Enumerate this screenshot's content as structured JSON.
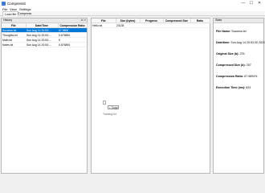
{
  "window": {
    "title": "Compressit",
    "minimize": "—",
    "maximize": "☐",
    "close": "✕"
  },
  "menu": [
    "File",
    "View",
    "Settings"
  ],
  "toolbar": {
    "tabs": [
      "Load file",
      "Compress"
    ]
  },
  "history": {
    "title": "History",
    "columns": [
      "File",
      "Date/Time",
      "Compression Ratio"
    ],
    "rows": [
      {
        "file": "Success.txt",
        "date": "Sun Aug 14 20:53:...",
        "ratio": "67.9894"
      },
      {
        "file": "Thoughts.txt",
        "date": "Sun Aug 14 20:53:...",
        "ratio": "0.675894"
      },
      {
        "file": "Math.txt",
        "date": "Sun Aug 14 20:53:...",
        "ratio": "5"
      },
      {
        "file": "Notes.txt",
        "date": "Sun Aug 14 20:53:...",
        "ratio": "0.676894"
      }
    ]
  },
  "files": {
    "columns": [
      "File",
      "Size (bytes)",
      "Progress",
      "Compressed Size",
      "Ratio"
    ],
    "rows": [
      {
        "file": "Hello.txt",
        "size": "23135",
        "progress": "",
        "compressed": "",
        "ratio": ""
      }
    ]
  },
  "drag": {
    "tooltip": "Copy",
    "filename": "Training.txt"
  },
  "stats": {
    "title": "Stats",
    "file_name_label": "File Name:",
    "file_name": "Success.txt",
    "datetime_label": "Date/time:",
    "datetime": "Sun Aug 14 20:53:30 2022",
    "orig_label": "Original Size (b):",
    "orig": "276",
    "comp_label": "Compressed Size (b):",
    "comp": "257",
    "ratio_label": "Compression Ratio:",
    "ratio": "67.9894%",
    "exec_label": "Execution Time (ms):",
    "exec": "624"
  }
}
